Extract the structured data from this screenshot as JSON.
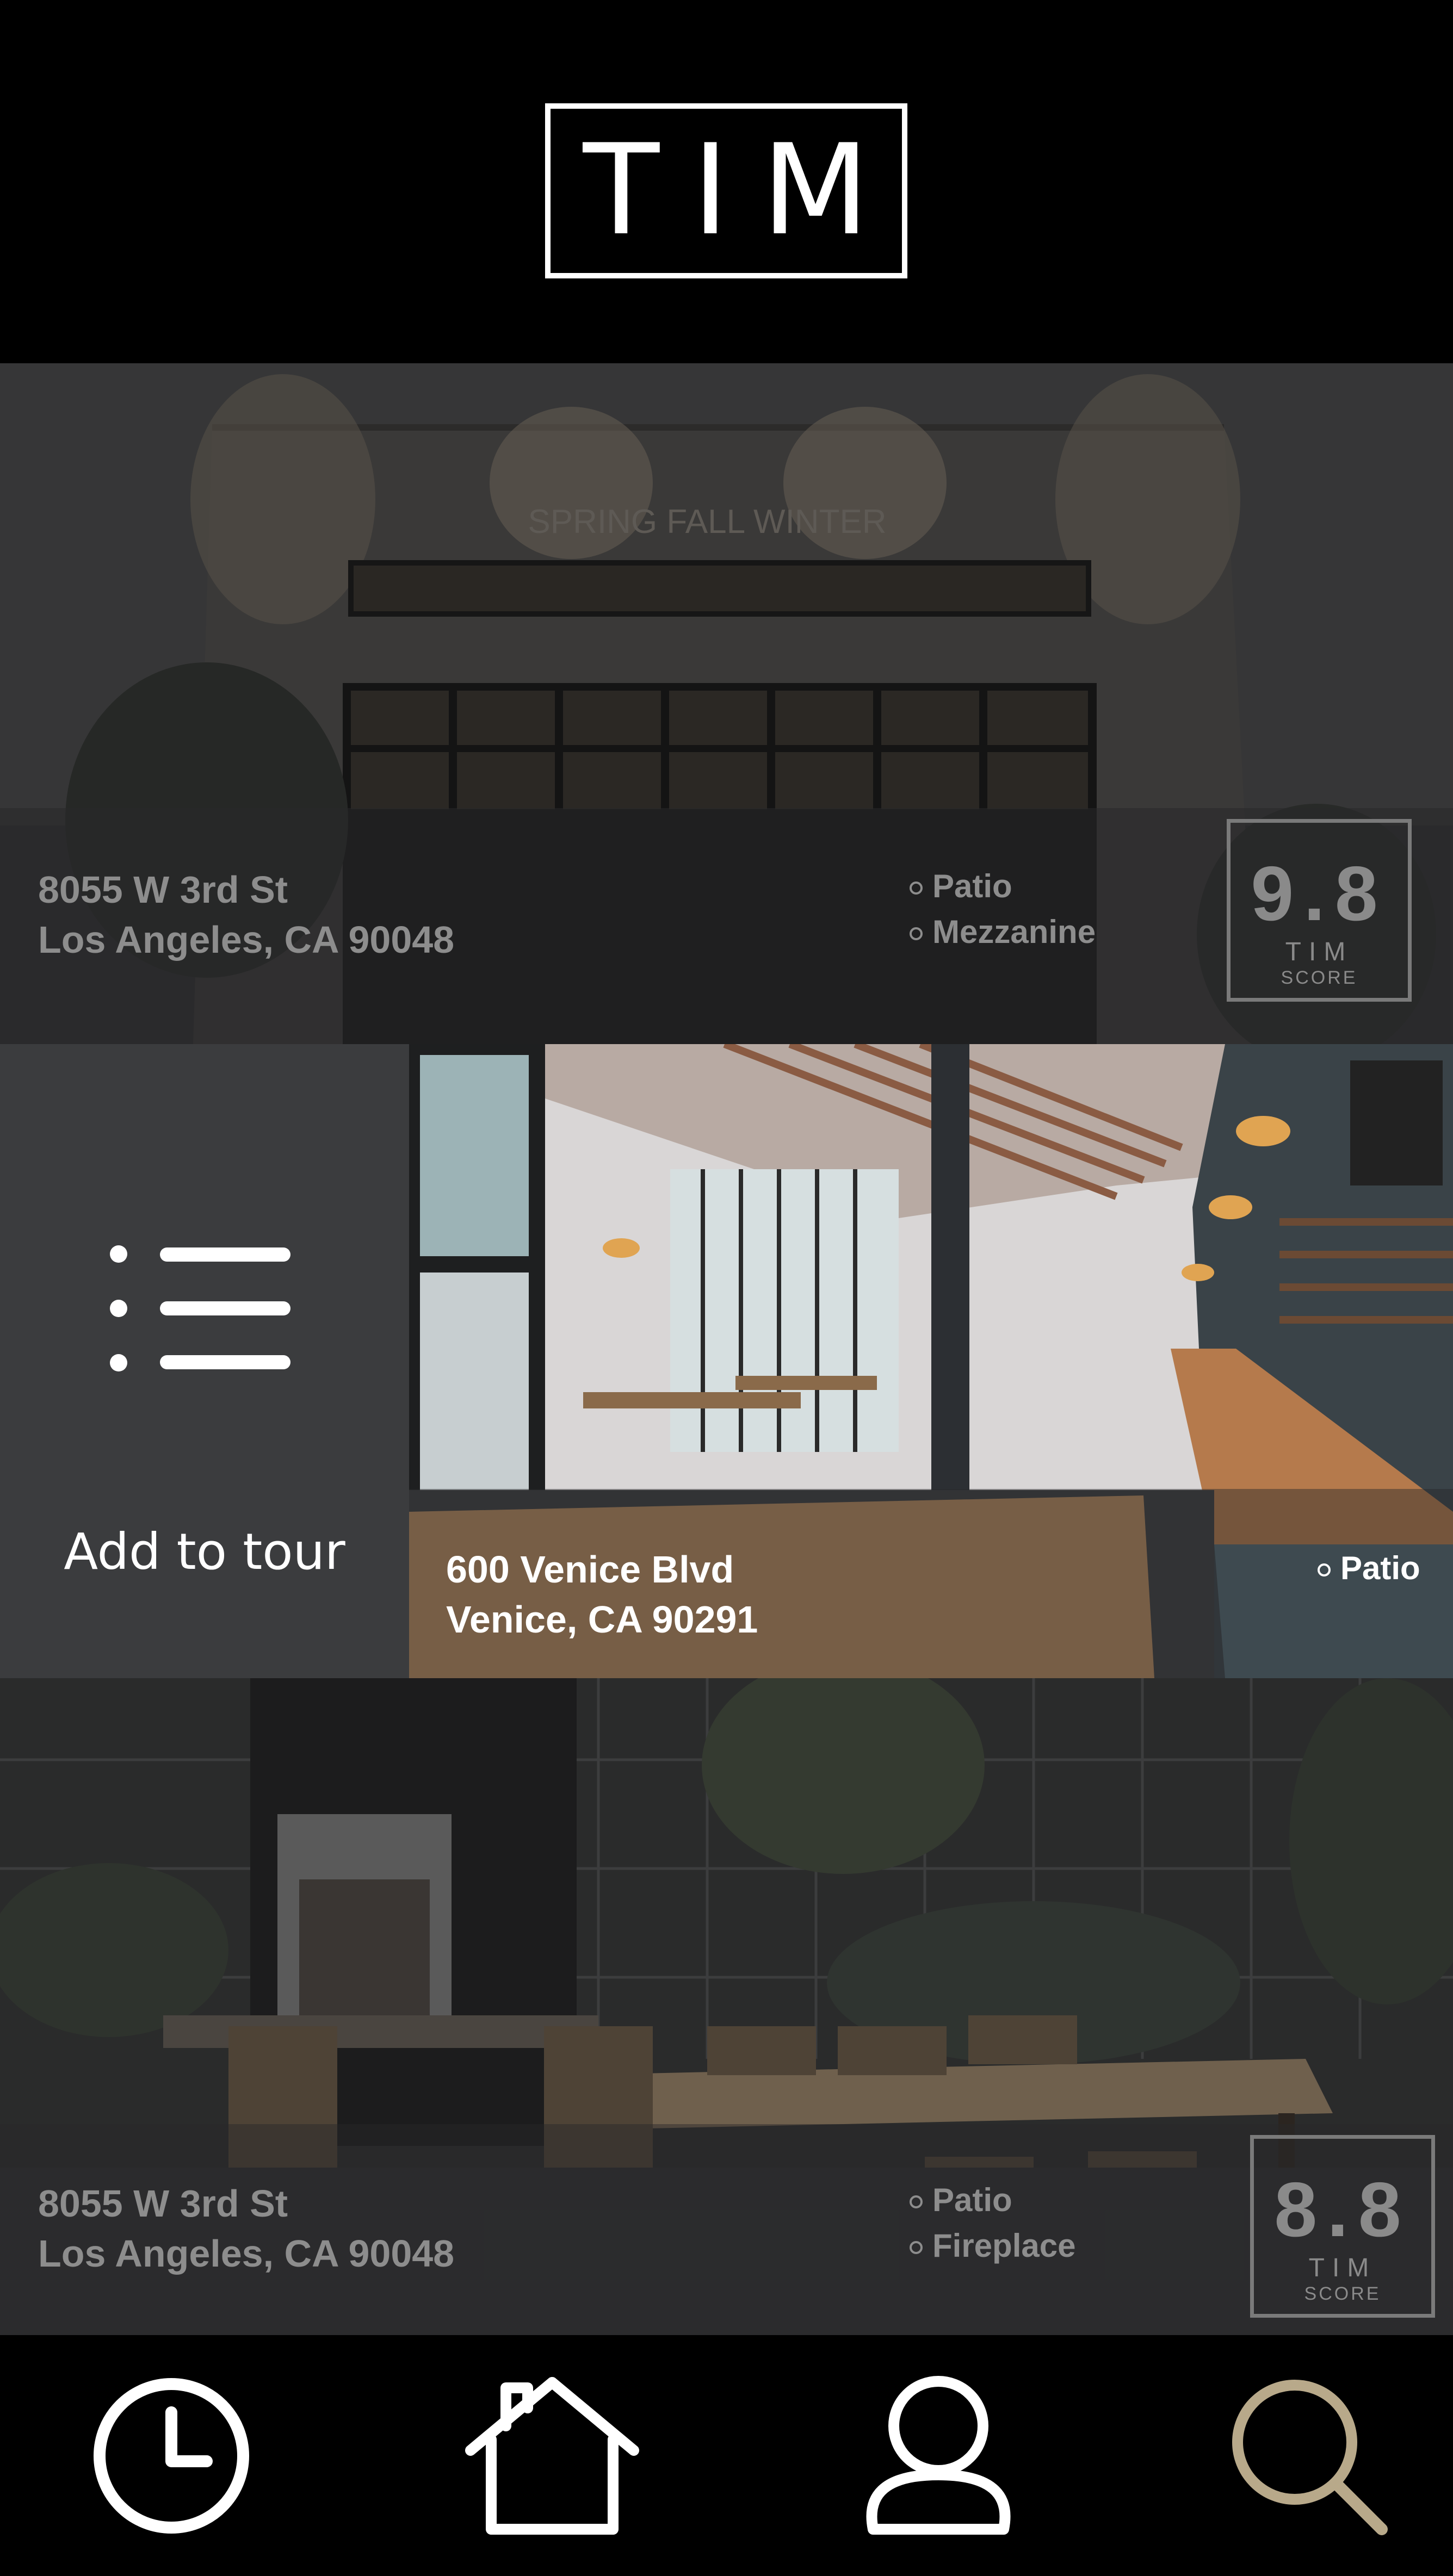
{
  "header": {
    "logo_text": "TIM"
  },
  "listings": [
    {
      "address_line1": "8055 W 3rd St",
      "address_line2": "Los Angeles, CA 90048",
      "features": [
        "Patio",
        "Mezzanine"
      ],
      "score": "9.8",
      "score_brand": "TIM",
      "score_label": "SCORE",
      "building_sign": "SPRING     FALL WINTER"
    },
    {
      "address_line1": "600 Venice Blvd",
      "address_line2": "Venice, CA 90291",
      "features": [
        "Patio"
      ],
      "action_label": "Add to tour",
      "action_icon": "list-icon"
    },
    {
      "address_line1": "8055 W 3rd St",
      "address_line2": "Los Angeles, CA 90048",
      "features": [
        "Patio",
        "Fireplace"
      ],
      "score": "8.8",
      "score_brand": "TIM",
      "score_label": "SCORE"
    }
  ],
  "nav": {
    "items": [
      {
        "icon": "clock-icon",
        "active": false
      },
      {
        "icon": "home-icon",
        "active": false
      },
      {
        "icon": "user-icon",
        "active": false
      },
      {
        "icon": "search-icon",
        "active": true
      }
    ],
    "active_color": "#b8a98a",
    "inactive_color": "#ffffff"
  }
}
